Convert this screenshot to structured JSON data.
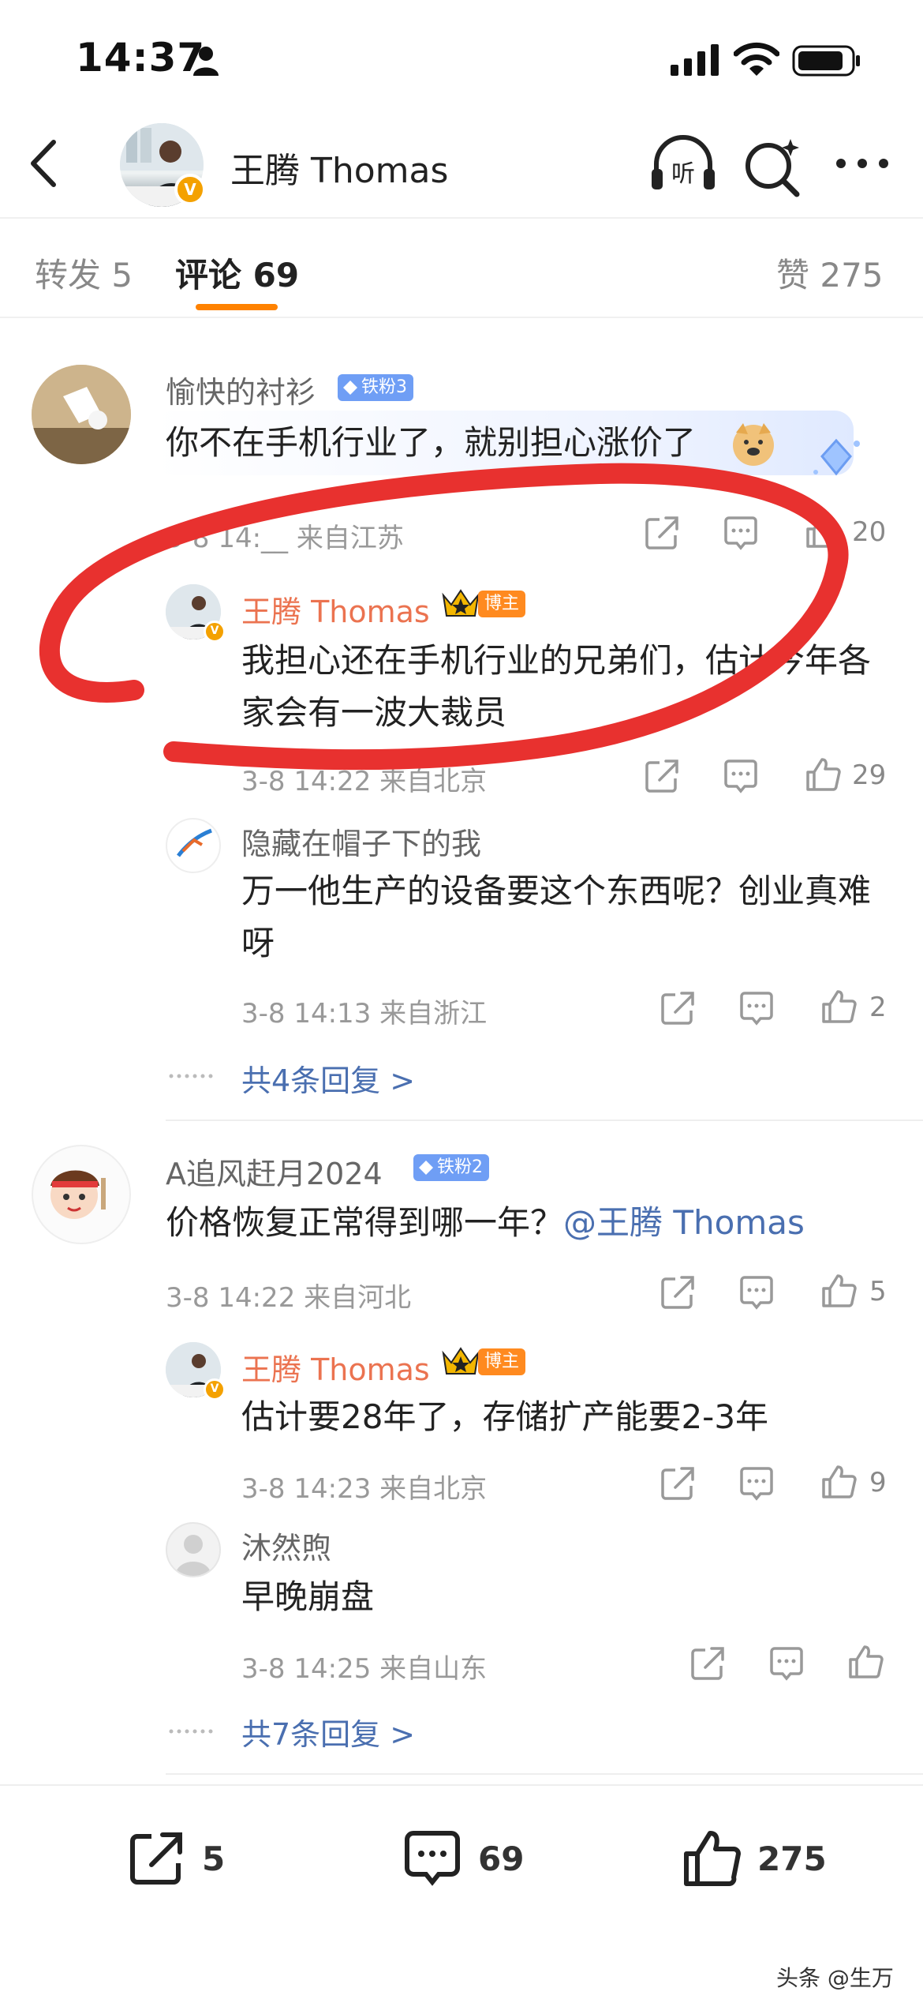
{
  "status_bar": {
    "time": "14:37"
  },
  "header": {
    "title": "王腾 Thomas",
    "verified_mark": "V"
  },
  "tabs": [
    {
      "label": "转发 5"
    },
    {
      "label": "评论 69"
    },
    {
      "label": "赞 275"
    }
  ],
  "comments": [
    {
      "name": "愉快的衬衫",
      "badge": "铁粉3",
      "content": "你不在手机行业了，就别担心涨价了",
      "meta": "3-8 14:__ 来自江苏",
      "likes": "20",
      "replies": [
        {
          "name": "王腾 Thomas",
          "badge": "博主",
          "content": "我担心还在手机行业的兄弟们，估计今年各家会有一波大裁员",
          "meta": "3-8 14:22 来自北京",
          "likes": "29"
        },
        {
          "name": "隐藏在帽子下的我",
          "content": "万一他生产的设备要这个东西呢？创业真难呀",
          "meta": "3-8 14:13 来自浙江",
          "likes": "2"
        }
      ],
      "more_replies": "共4条回复 >"
    },
    {
      "name": "A追风赶月2024",
      "badge": "铁粉2",
      "content": "价格恢复正常得到哪一年？",
      "mention": "@王腾 Thomas",
      "meta": "3-8 14:22 来自河北",
      "likes": "5",
      "replies": [
        {
          "name": "王腾 Thomas",
          "badge": "博主",
          "content": "估计要28年了，存储扩产能要2-3年",
          "meta": "3-8 14:23 来自北京",
          "likes": "9"
        },
        {
          "name": "沐然煦",
          "content": "早晚崩盘",
          "meta": "3-8 14:25 来自山东",
          "likes": ""
        }
      ],
      "more_replies": "共7条回复 >"
    }
  ],
  "bottom_bar": {
    "reposts": "5",
    "comments": "69",
    "likes": "275"
  },
  "watermark": "头条 @生万",
  "colors": {
    "accent": "#ff8200",
    "link": "#4a6fb0",
    "vip_name": "#eb7350",
    "scribble": "#e8312f"
  }
}
